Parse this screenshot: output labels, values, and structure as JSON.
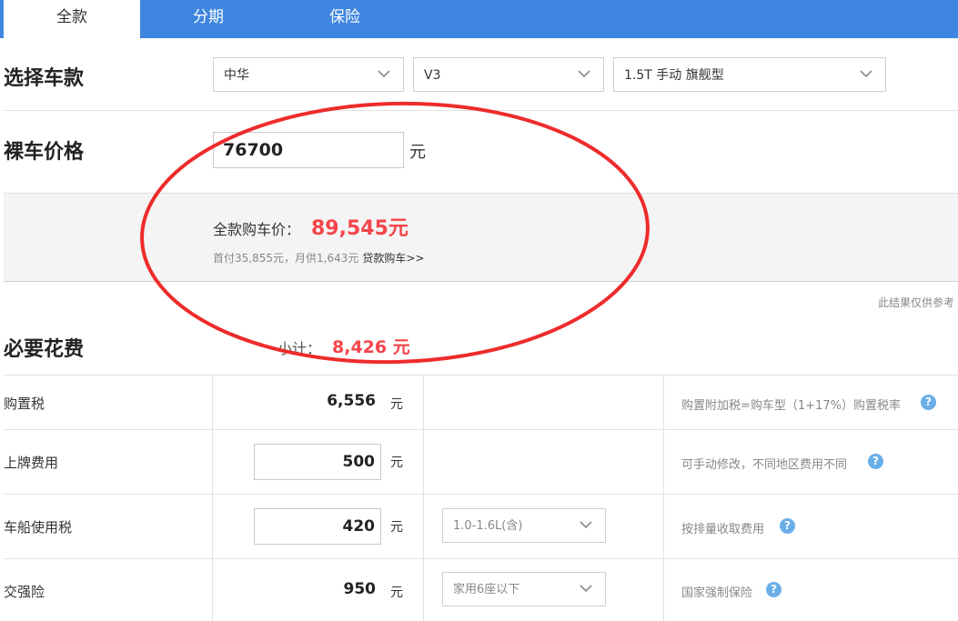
{
  "tabs": [
    {
      "label": "全款",
      "active": true
    },
    {
      "label": "分期",
      "active": false
    },
    {
      "label": "保险",
      "active": false
    }
  ],
  "select_model": {
    "title": "选择车款",
    "brand": "中华",
    "series": "V3",
    "trim": "1.5T 手动 旗舰型"
  },
  "bare_price": {
    "title": "裸车价格",
    "value": "76700",
    "unit": "元"
  },
  "summary": {
    "label": "全款购车价：",
    "value": "89,545元",
    "sub_text": "首付35,855元，月供1,643元",
    "loan_link": "贷款购车>>"
  },
  "note": "此结果仅供参考",
  "required_costs": {
    "title": "必要花费",
    "subtotal_label": "小计：",
    "subtotal_value": "8,426 元",
    "rows": [
      {
        "label": "购置税",
        "value": "6,556",
        "unit": "元",
        "desc": "购置附加税=购车型（1+17%）购置税率"
      },
      {
        "label": "上牌费用",
        "value": "500",
        "unit": "元",
        "desc": "可手动修改，不同地区费用不同"
      },
      {
        "label": "车船使用税",
        "value": "420",
        "unit": "元",
        "option": "1.0-1.6L(含)",
        "desc": "按排量收取费用"
      },
      {
        "label": "交强险",
        "value": "950",
        "unit": "元",
        "option": "家用6座以下",
        "desc": "国家强制保险"
      }
    ]
  },
  "colors": {
    "tab_bar": "#3f86e0",
    "highlight_red": "#f5454a",
    "help_icon": "#6aaee8",
    "annotation": "#ee2b2b"
  },
  "icons": {
    "dropdown": "chevron-down-icon",
    "help": "question-mark-icon"
  }
}
